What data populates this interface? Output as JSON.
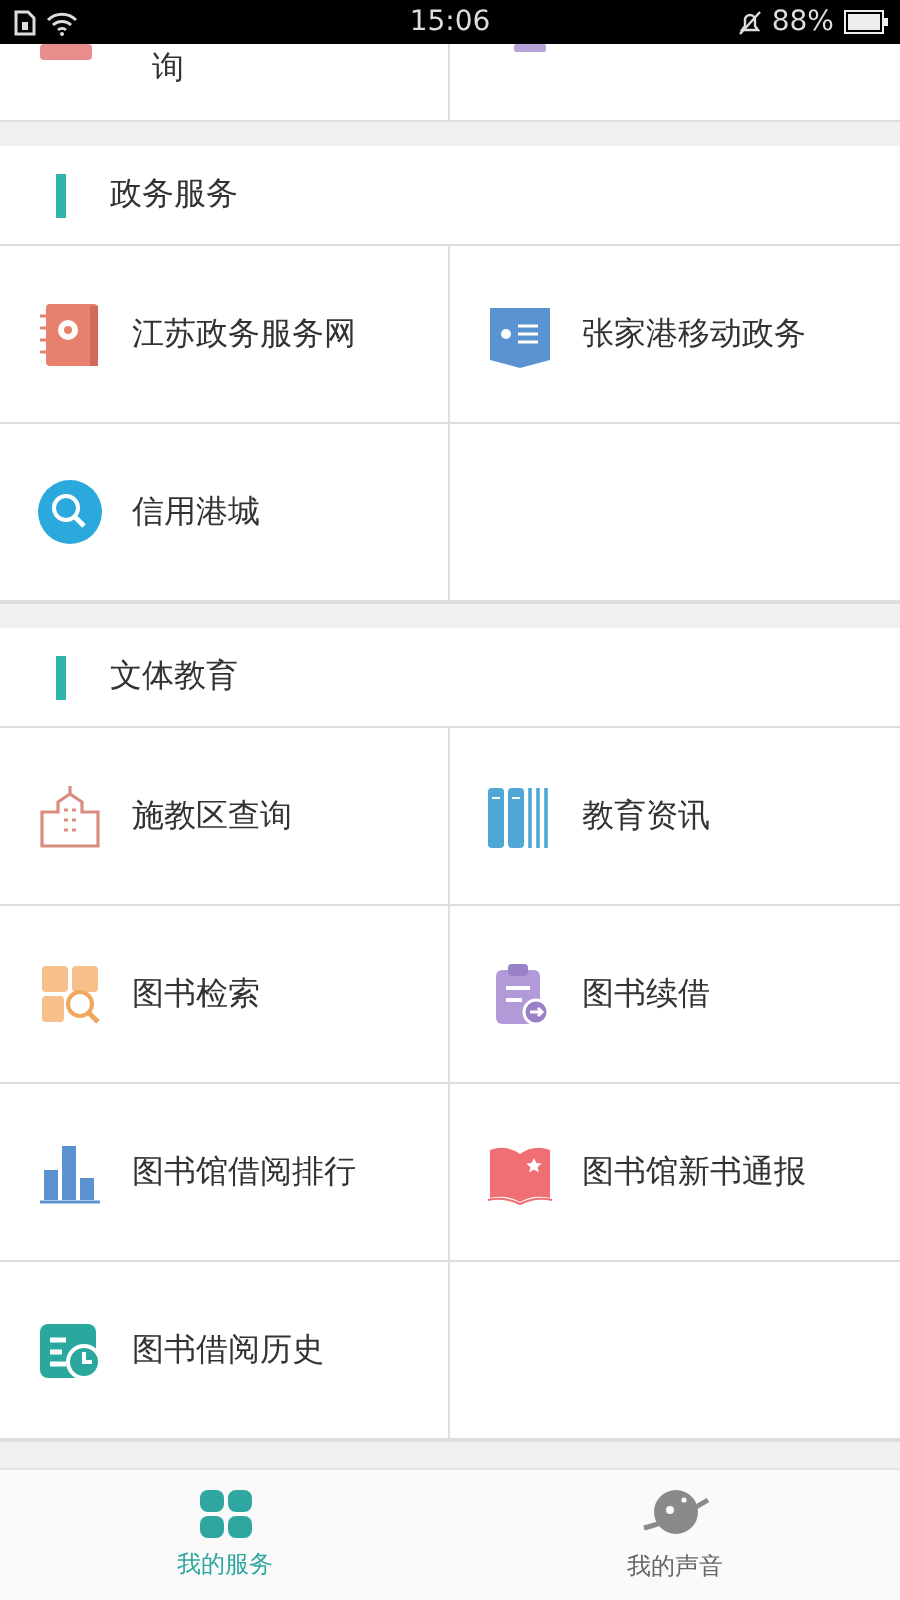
{
  "status_bar": {
    "time": "15:06",
    "battery": "88%"
  },
  "partial_row": {
    "label": "询"
  },
  "sections": [
    {
      "title": "政务服务",
      "items": [
        {
          "label": "江苏政务服务网"
        },
        {
          "label": "张家港移动政务"
        },
        {
          "label": "信用港城"
        }
      ]
    },
    {
      "title": "文体教育",
      "items": [
        {
          "label": "施教区查询"
        },
        {
          "label": "教育资讯"
        },
        {
          "label": "图书检索"
        },
        {
          "label": "图书续借"
        },
        {
          "label": "图书馆借阅排行"
        },
        {
          "label": "图书馆新书通报"
        },
        {
          "label": "图书借阅历史"
        }
      ]
    }
  ],
  "tabs": [
    {
      "label": "我的服务",
      "selected": true
    },
    {
      "label": "我的声音",
      "selected": false
    }
  ]
}
